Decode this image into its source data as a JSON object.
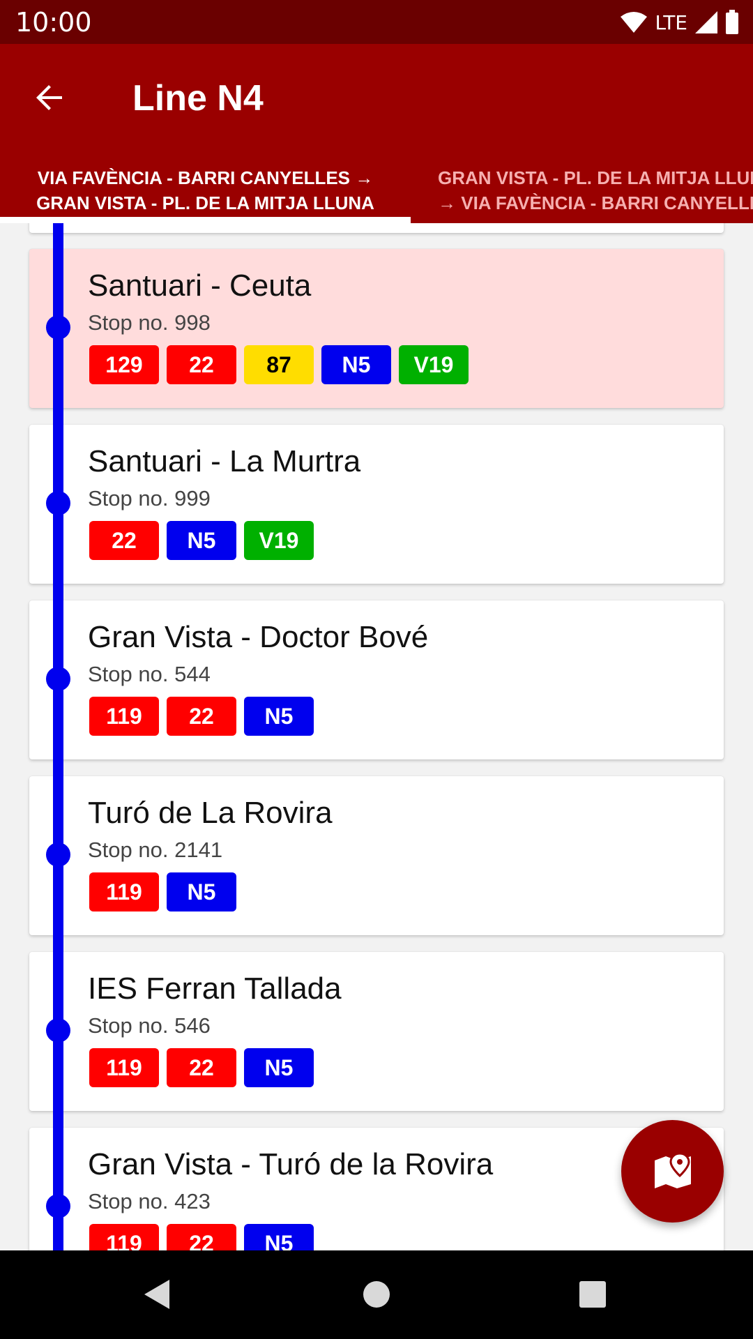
{
  "status_bar": {
    "time": "10:00",
    "network": "LTE"
  },
  "app_bar": {
    "title": "Line N4"
  },
  "tabs": [
    {
      "label": "VIA FAVÈNCIA - BARRI CANYELLES →\nGRAN VISTA - PL. DE LA MITJA LLUNA",
      "selected": true
    },
    {
      "label": "GRAN VISTA - PL. DE LA MITJA LLUNA\n→ VIA FAVÈNCIA - BARRI CANYELLES",
      "selected": false
    }
  ],
  "colors": {
    "status_bar": "#6a0000",
    "app_bar": "#9a0000",
    "route_line": "#0000ee",
    "highlight_card": "#ffdcdc",
    "badge_red": "#ff0000",
    "badge_yellow": "#ffdd00",
    "badge_blue": "#0000ee",
    "badge_green": "#00b000"
  },
  "stops": [
    {
      "name": "Santuari - Ceuta",
      "number": "Stop no. 998",
      "highlighted": true,
      "lines": [
        {
          "label": "129",
          "color": "red"
        },
        {
          "label": "22",
          "color": "red"
        },
        {
          "label": "87",
          "color": "yellow"
        },
        {
          "label": "N5",
          "color": "blue"
        },
        {
          "label": "V19",
          "color": "green"
        }
      ]
    },
    {
      "name": "Santuari - La Murtra",
      "number": "Stop no. 999",
      "highlighted": false,
      "lines": [
        {
          "label": "22",
          "color": "red"
        },
        {
          "label": "N5",
          "color": "blue"
        },
        {
          "label": "V19",
          "color": "green"
        }
      ]
    },
    {
      "name": "Gran Vista - Doctor Bové",
      "number": "Stop no. 544",
      "highlighted": false,
      "lines": [
        {
          "label": "119",
          "color": "red"
        },
        {
          "label": "22",
          "color": "red"
        },
        {
          "label": "N5",
          "color": "blue"
        }
      ]
    },
    {
      "name": "Turó de La Rovira",
      "number": "Stop no. 2141",
      "highlighted": false,
      "lines": [
        {
          "label": "119",
          "color": "red"
        },
        {
          "label": "N5",
          "color": "blue"
        }
      ]
    },
    {
      "name": "IES Ferran Tallada",
      "number": "Stop no. 546",
      "highlighted": false,
      "lines": [
        {
          "label": "119",
          "color": "red"
        },
        {
          "label": "22",
          "color": "red"
        },
        {
          "label": "N5",
          "color": "blue"
        }
      ]
    },
    {
      "name": "Gran Vista - Turó de la Rovira",
      "number": "Stop no. 423",
      "highlighted": false,
      "lines": [
        {
          "label": "119",
          "color": "red"
        },
        {
          "label": "22",
          "color": "red"
        },
        {
          "label": "N5",
          "color": "blue"
        }
      ]
    }
  ],
  "icons": {
    "back": "arrow-left-icon",
    "map_fab": "map-pin-icon",
    "nav_back": "triangle-back-icon",
    "nav_home": "circle-home-icon",
    "nav_recents": "square-recents-icon"
  }
}
